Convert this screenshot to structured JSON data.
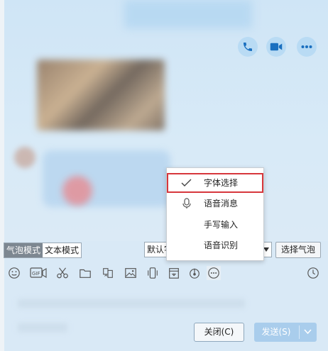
{
  "header": {
    "icons": [
      "phone-icon",
      "video-icon",
      "more-icon"
    ]
  },
  "bubble_mode": {
    "bubble_label": "气泡模式",
    "text_label": "文本模式",
    "font_value": "默认字",
    "select_bubble_label": "选择气泡"
  },
  "toolbar": {
    "icons": [
      "emoji-icon",
      "gif-icon",
      "scissors-icon",
      "folder-icon",
      "image-wall-icon",
      "image-icon",
      "shake-icon",
      "calendar-icon",
      "music-icon",
      "more-circle-icon",
      "history-icon"
    ]
  },
  "context_menu": {
    "items": [
      {
        "label": "字体选择",
        "checked": true,
        "highlighted": true
      },
      {
        "label": "语音消息",
        "icon": "mic-icon"
      },
      {
        "label": "手写输入"
      },
      {
        "label": "语音识别"
      }
    ]
  },
  "footer": {
    "close_label": "关闭(C)",
    "send_label": "发送(S)"
  },
  "colors": {
    "background": "#d9e9f6",
    "accent": "#1a6fbf",
    "highlight_border": "#d7373c",
    "send_button": "#a9cdec"
  }
}
